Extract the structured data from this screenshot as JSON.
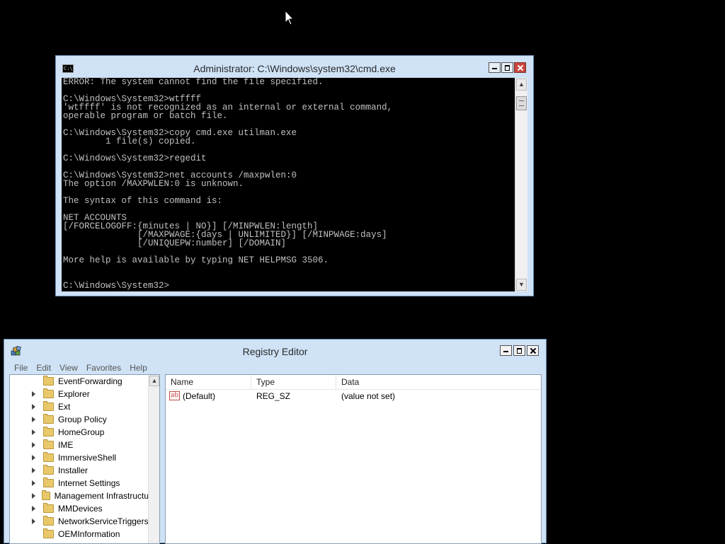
{
  "cmd": {
    "title": "Administrator: C:\\Windows\\system32\\cmd.exe",
    "icon_text": "C:\\.",
    "output": "ERROR: The system cannot find the file specified.\n\nC:\\Windows\\System32>wtffff\n'wtffff' is not recognized as an internal or external command,\noperable program or batch file.\n\nC:\\Windows\\System32>copy cmd.exe utilman.exe\n        1 file(s) copied.\n\nC:\\Windows\\System32>regedit\n\nC:\\Windows\\System32>net accounts /maxpwlen:0\nThe option /MAXPWLEN:0 is unknown.\n\nThe syntax of this command is:\n\nNET ACCOUNTS\n[/FORCELOGOFF:{minutes | NO}] [/MINPWLEN:length]\n              [/MAXPWAGE:{days | UNLIMITED}] [/MINPWAGE:days]\n              [/UNIQUEPW:number] [/DOMAIN]\n\nMore help is available by typing NET HELPMSG 3506.\n\n\nC:\\Windows\\System32>",
    "scroll_up_glyph": "▲",
    "scroll_down_glyph": "▼"
  },
  "regedit": {
    "title": "Registry Editor",
    "menu": [
      "File",
      "Edit",
      "View",
      "Favorites",
      "Help"
    ],
    "tree": [
      {
        "label": "EventForwarding",
        "expandable": false
      },
      {
        "label": "Explorer",
        "expandable": true
      },
      {
        "label": "Ext",
        "expandable": true
      },
      {
        "label": "Group Policy",
        "expandable": true
      },
      {
        "label": "HomeGroup",
        "expandable": true
      },
      {
        "label": "IME",
        "expandable": true
      },
      {
        "label": "ImmersiveShell",
        "expandable": true
      },
      {
        "label": "Installer",
        "expandable": true
      },
      {
        "label": "Internet Settings",
        "expandable": true
      },
      {
        "label": "Management Infrastructu",
        "expandable": true
      },
      {
        "label": "MMDevices",
        "expandable": true
      },
      {
        "label": "NetworkServiceTriggers",
        "expandable": true
      },
      {
        "label": "OEMInformation",
        "expandable": false
      }
    ],
    "columns": {
      "name": "Name",
      "type": "Type",
      "data": "Data"
    },
    "values": [
      {
        "icon": "ab",
        "name": "(Default)",
        "type": "REG_SZ",
        "data": "(value not set)"
      }
    ],
    "scroll_up_glyph": "▲"
  },
  "colors": {
    "desktop": "#000000",
    "window_frame": "#cfe2f6",
    "close_button": "#c9463d",
    "console_text": "#c0c0c0",
    "folder": "#e9c86a"
  }
}
